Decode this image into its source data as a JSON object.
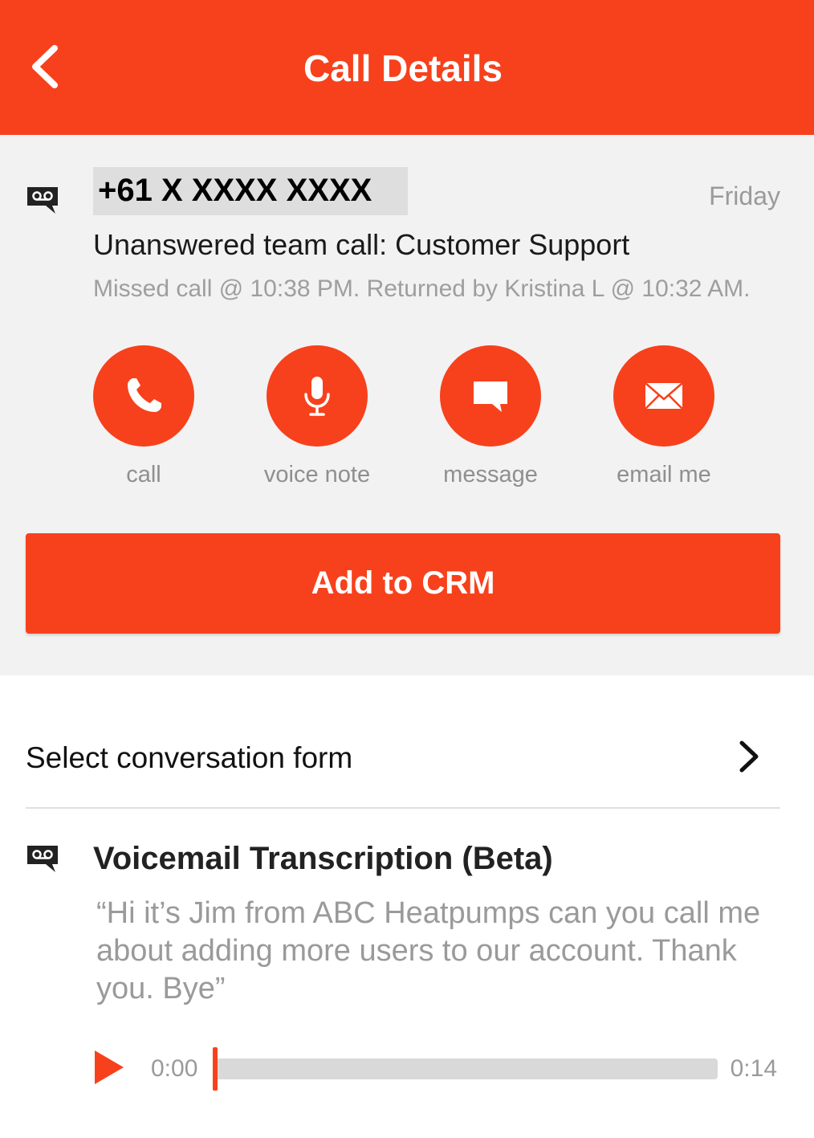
{
  "header": {
    "title": "Call Details",
    "back_icon": "chevron-left-icon"
  },
  "call": {
    "icon": "voicemail-icon",
    "phone_number": "+61 X XXXX XXXX",
    "date": "Friday",
    "title": "Unanswered team call: Customer Support",
    "status": "Missed call @ 10:38 PM. Returned by Kristina  L @ 10:32 AM."
  },
  "actions": [
    {
      "label": "call",
      "icon": "phone-icon"
    },
    {
      "label": "voice note",
      "icon": "microphone-icon"
    },
    {
      "label": "message",
      "icon": "message-icon"
    },
    {
      "label": "email me",
      "icon": "envelope-icon"
    }
  ],
  "crm_button": {
    "label": "Add to CRM"
  },
  "conversation_form": {
    "label": "Select conversation form",
    "icon": "chevron-right-icon"
  },
  "transcription": {
    "icon": "voicemail-icon",
    "title": "Voicemail Transcription (Beta)",
    "text": "“Hi it’s Jim from ABC Heatpumps can you call me about adding more users to our account. Thank you. Bye”"
  },
  "player": {
    "play_icon": "play-icon",
    "current_time": "0:00",
    "duration": "0:14",
    "progress": 0
  },
  "colors": {
    "accent": "#f7411c",
    "panel_background": "#f2f2f2",
    "muted_text": "#9a9a9a"
  }
}
